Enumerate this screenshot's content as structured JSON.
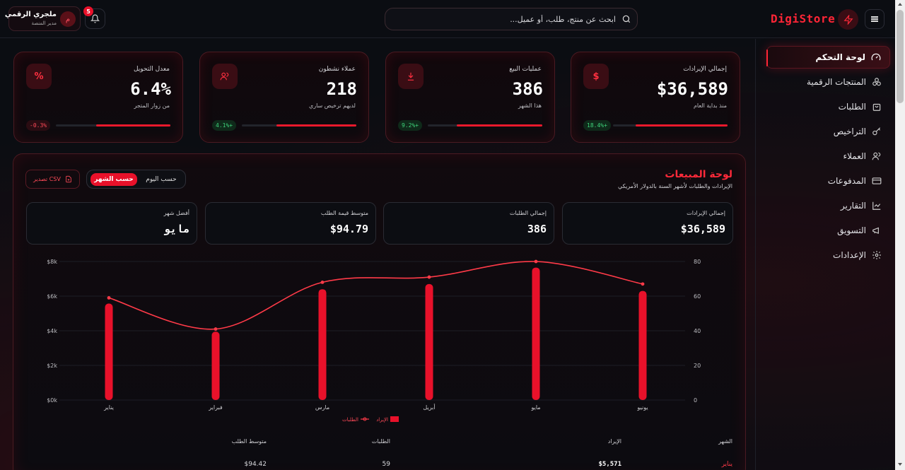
{
  "header": {
    "brand": "DigiStore",
    "search_placeholder": "ابحث عن منتج، طلب، أو عميل...",
    "notifications_count": "5",
    "user_name": "ملجري الرقمي",
    "user_role": "مدير المنصة",
    "user_initial": "م"
  },
  "sidebar": {
    "items": [
      {
        "label": "لوحة التحكم",
        "icon": "gauge-icon",
        "active": true
      },
      {
        "label": "المنتجات الرقمية",
        "icon": "boxes-icon"
      },
      {
        "label": "الطلبات",
        "icon": "bag-icon"
      },
      {
        "label": "التراخيص",
        "icon": "key-icon"
      },
      {
        "label": "العملاء",
        "icon": "users-icon"
      },
      {
        "label": "المدفوعات",
        "icon": "card-icon"
      },
      {
        "label": "التقارير",
        "icon": "chart-icon"
      },
      {
        "label": "التسويق",
        "icon": "megaphone-icon"
      },
      {
        "label": "الإعدادات",
        "icon": "gear-icon"
      }
    ]
  },
  "kpis": [
    {
      "label": "إجمالي الإيرادات",
      "value": "$36,589",
      "sub": "منذ بداية العام",
      "badge": "18.4%+",
      "trend": "up",
      "icon": "$",
      "progress": 0.8
    },
    {
      "label": "عمليات البيع",
      "value": "386",
      "sub": "هذا الشهر",
      "badge": "9.2%+",
      "trend": "up",
      "icon": "⤓",
      "progress": 0.75
    },
    {
      "label": "عملاء نشطون",
      "value": "218",
      "sub": "لديهم ترخيص ساري",
      "badge": "4.1%+",
      "trend": "up",
      "icon": "👥",
      "progress": 0.7
    },
    {
      "label": "معدل التحويل",
      "value": "6.4%",
      "sub": "من زوار المتجر",
      "badge": "-0.3%",
      "trend": "down",
      "icon": "%",
      "progress": 0.65
    }
  ],
  "panel": {
    "title": "لوحة المبيعات",
    "subtitle": "الإيرادات والطلبات لأشهر السنة بالدولار الأمريكي",
    "toggle_month": "حسب الشهر",
    "toggle_day": "حسب اليوم",
    "export_label": "تصدير CSV",
    "stats": [
      {
        "label": "إجمالي الإيرادات",
        "value": "$36,589"
      },
      {
        "label": "إجمالي الطلبات",
        "value": "386"
      },
      {
        "label": "متوسط قيمة الطلب",
        "value": "$94.79"
      },
      {
        "label": "أفضل شهر",
        "value": "مايو"
      }
    ],
    "legend_revenue": "الإيراد",
    "legend_orders": "الطلبات",
    "table_headers": [
      "الشهر",
      "الإيراد",
      "الطلبات",
      "متوسط الطلب"
    ],
    "first_row": [
      "يناير",
      "$5,571",
      "59",
      "$94.42"
    ]
  },
  "chart_data": {
    "type": "bar",
    "categories": [
      "يناير",
      "فبراير",
      "مارس",
      "أبريل",
      "مايو",
      "يونيو"
    ],
    "series": [
      {
        "name": "الإيراد",
        "type": "bar",
        "axis": "left",
        "values": [
          5571,
          3950,
          6400,
          6700,
          7650,
          6300
        ]
      },
      {
        "name": "الطلبات",
        "type": "line",
        "axis": "right",
        "values": [
          59,
          41,
          68,
          71,
          80,
          67
        ]
      }
    ],
    "y_left_ticks": [
      "$0k",
      "$2k",
      "$4k",
      "$6k",
      "$8k"
    ],
    "y_left_range": [
      0,
      8000
    ],
    "y_right_ticks": [
      "0",
      "20",
      "40",
      "60",
      "80"
    ],
    "y_right_range": [
      0,
      80
    ],
    "colors": {
      "bar": "#e8112a",
      "line": "#ff3a48"
    },
    "legend": "bottom-center"
  }
}
